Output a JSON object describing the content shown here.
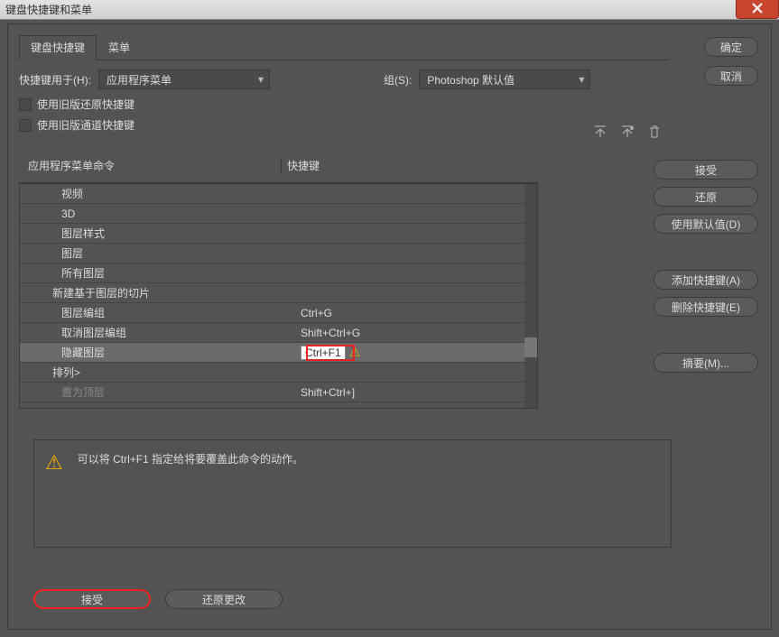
{
  "window": {
    "title": "键盘快捷键和菜单"
  },
  "tabs": {
    "shortcut": "键盘快捷键",
    "menu": "菜单"
  },
  "buttons": {
    "ok": "确定",
    "cancel": "取消"
  },
  "form": {
    "shortcuts_for_label": "快捷键用于(H):",
    "shortcuts_for_value": "应用程序菜单",
    "set_label": "组(S):",
    "set_value": "Photoshop 默认值",
    "use_legacy_undo": "使用旧版还原快捷键",
    "use_legacy_channel": "使用旧版通道快捷键"
  },
  "table": {
    "col1": "应用程序菜单命令",
    "col2": "快捷键",
    "rows": [
      {
        "name": "视频",
        "shortcut": ""
      },
      {
        "name": "3D",
        "shortcut": ""
      },
      {
        "name": "图层样式",
        "shortcut": ""
      },
      {
        "name": "图层",
        "shortcut": ""
      },
      {
        "name": "所有图层",
        "shortcut": ""
      },
      {
        "name": "新建基于图层的切片",
        "shortcut": "",
        "indent": true
      },
      {
        "name": "图层编组",
        "shortcut": "Ctrl+G"
      },
      {
        "name": "取消图层编组",
        "shortcut": "Shift+Ctrl+G"
      },
      {
        "name": "隐藏图层",
        "shortcut": "Ctrl+F1",
        "selected": true,
        "warn": true
      },
      {
        "name": "排列>",
        "shortcut": "",
        "indent": true
      },
      {
        "name": "置为顶层",
        "shortcut": "Shift+Ctrl+]",
        "fade": true
      }
    ]
  },
  "side": {
    "accept": "接受",
    "undo": "还原",
    "use_default": "使用默认值(D)",
    "add_shortcut": "添加快捷键(A)",
    "delete_shortcut": "删除快捷键(E)",
    "summary": "摘要(M)..."
  },
  "message": "可以将 Ctrl+F1 指定给将要覆盖此命令的动作。",
  "bottom": {
    "accept": "接受",
    "undo_changes": "还原更改"
  }
}
